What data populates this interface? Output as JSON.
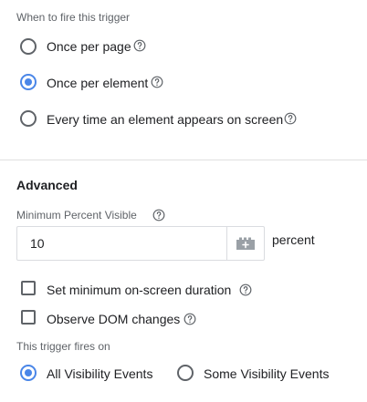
{
  "fire_trigger": {
    "label": "When to fire this trigger",
    "options": [
      {
        "label": "Once per page",
        "checked": false
      },
      {
        "label": "Once per element",
        "checked": true
      },
      {
        "label": "Every time an element appears on screen",
        "checked": false
      }
    ]
  },
  "advanced": {
    "heading": "Advanced",
    "min_percent": {
      "label": "Minimum Percent Visible",
      "value": "10",
      "suffix": "percent"
    },
    "checkboxes": [
      {
        "label": "Set minimum on-screen duration",
        "checked": false
      },
      {
        "label": "Observe DOM changes",
        "checked": false
      }
    ]
  },
  "fires_on": {
    "label": "This trigger fires on",
    "options": [
      {
        "label": "All Visibility Events",
        "checked": true
      },
      {
        "label": "Some Visibility Events",
        "checked": false
      }
    ]
  },
  "colors": {
    "accent": "#4a86e8",
    "control_border": "#5f6368",
    "divider": "#e0e0e0"
  }
}
